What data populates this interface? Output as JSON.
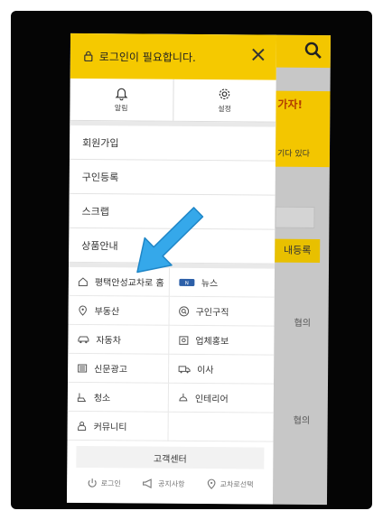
{
  "drawer": {
    "login_message": "로그인이 필요합니다.",
    "quick": [
      {
        "label": "알림",
        "icon": "bell-icon"
      },
      {
        "label": "설정",
        "icon": "gear-icon"
      }
    ],
    "menu": [
      "회원가입",
      "구인등록",
      "스크랩",
      "상품안내"
    ],
    "categories": [
      {
        "label": "평택안성교차로 홈",
        "icon": "home-icon"
      },
      {
        "label": "뉴스",
        "icon": "news-icon"
      },
      {
        "label": "부동산",
        "icon": "location-pin-icon"
      },
      {
        "label": "구인구직",
        "icon": "search-icon"
      },
      {
        "label": "자동차",
        "icon": "car-icon"
      },
      {
        "label": "업체홍보",
        "icon": "store-icon"
      },
      {
        "label": "신문광고",
        "icon": "newspaper-icon"
      },
      {
        "label": "이사",
        "icon": "truck-icon"
      },
      {
        "label": "청소",
        "icon": "broom-icon"
      },
      {
        "label": "인테리어",
        "icon": "lamp-icon"
      },
      {
        "label": "커뮤니티",
        "icon": "people-icon"
      },
      {
        "label": "",
        "icon": ""
      }
    ],
    "customer_center": "고객센터",
    "bottom": [
      {
        "label": "로그인",
        "icon": "power-icon"
      },
      {
        "label": "공지사항",
        "icon": "megaphone-icon"
      },
      {
        "label": "교차로선택",
        "icon": "location-pin-icon"
      }
    ]
  },
  "background": {
    "banner_line1": "가자!",
    "banner_line2": "기다 있다",
    "register_button": "내등록",
    "table_cell1": "협의",
    "table_cell2": "협의"
  },
  "colors": {
    "accent": "#f5c900",
    "arrow": "#35a8ea"
  }
}
